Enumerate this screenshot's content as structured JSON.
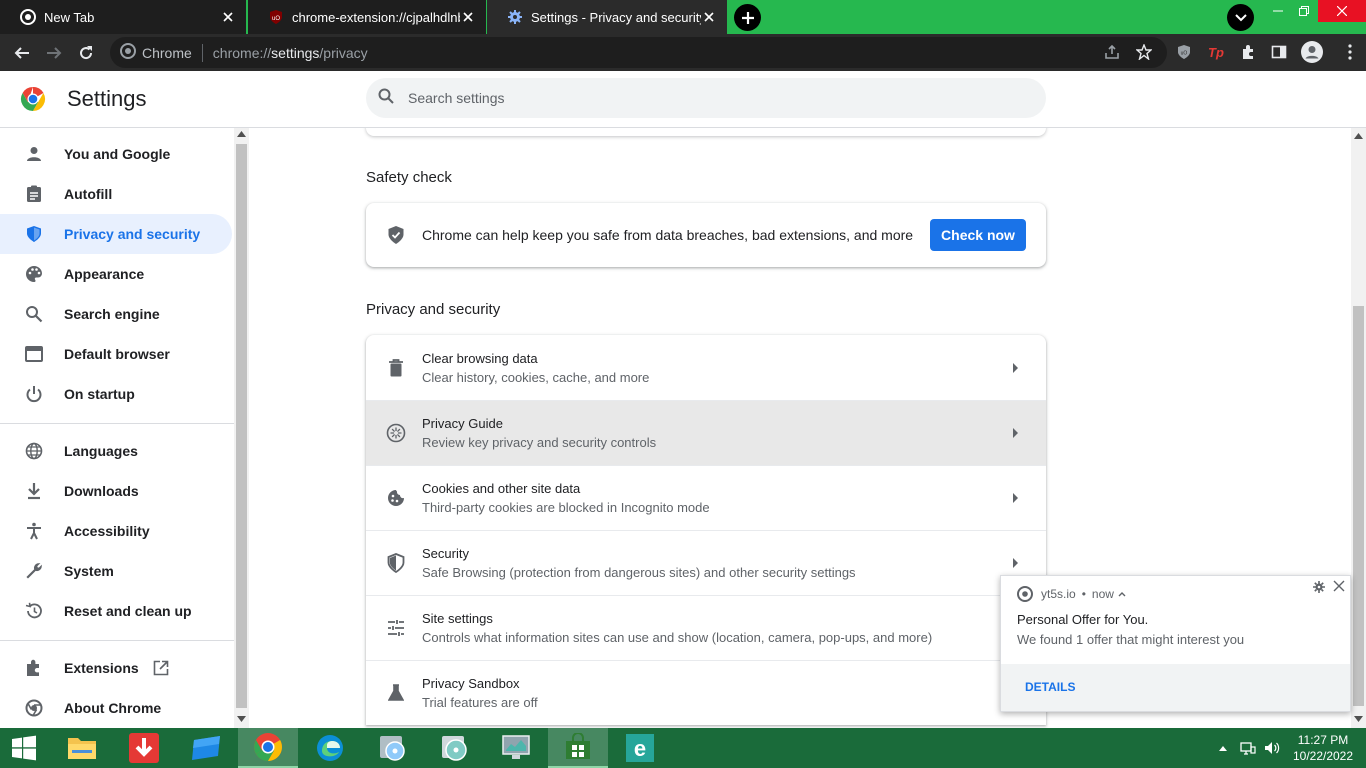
{
  "tabs": [
    {
      "title": "New Tab",
      "icon": "chrome-icon"
    },
    {
      "title": "chrome-extension://cjpalhdlnbpafiamejdnhcphjbkeiagm",
      "icon": "ublock-icon"
    },
    {
      "title": "Settings - Privacy and security",
      "icon": "gear-icon",
      "active": true
    }
  ],
  "toolbar": {
    "omnibox_site": "Chrome",
    "url_prefix": "chrome://",
    "url_host": "settings",
    "url_path": "/privacy"
  },
  "header": {
    "title": "Settings",
    "search_placeholder": "Search settings"
  },
  "sidebar": {
    "items": [
      {
        "label": "You and Google",
        "icon": "person-icon"
      },
      {
        "label": "Autofill",
        "icon": "clipboard-icon"
      },
      {
        "label": "Privacy and security",
        "icon": "shield-icon",
        "active": true
      },
      {
        "label": "Appearance",
        "icon": "palette-icon"
      },
      {
        "label": "Search engine",
        "icon": "search-icon"
      },
      {
        "label": "Default browser",
        "icon": "browser-icon"
      },
      {
        "label": "On startup",
        "icon": "power-icon"
      },
      {
        "label": "Languages",
        "icon": "globe-icon"
      },
      {
        "label": "Downloads",
        "icon": "download-icon"
      },
      {
        "label": "Accessibility",
        "icon": "accessibility-icon"
      },
      {
        "label": "System",
        "icon": "wrench-icon"
      },
      {
        "label": "Reset and clean up",
        "icon": "history-icon"
      },
      {
        "label": "Extensions",
        "icon": "puzzle-icon"
      },
      {
        "label": "About Chrome",
        "icon": "chrome-icon"
      }
    ]
  },
  "safety_check": {
    "heading": "Safety check",
    "text": "Chrome can help keep you safe from data breaches, bad extensions, and more",
    "button": "Check now"
  },
  "privacy": {
    "heading": "Privacy and security",
    "rows": [
      {
        "title": "Clear browsing data",
        "subtitle": "Clear history, cookies, cache, and more",
        "icon": "trash-icon"
      },
      {
        "title": "Privacy Guide",
        "subtitle": "Review key privacy and security controls",
        "icon": "compass-icon"
      },
      {
        "title": "Cookies and other site data",
        "subtitle": "Third-party cookies are blocked in Incognito mode",
        "icon": "cookie-icon"
      },
      {
        "title": "Security",
        "subtitle": "Safe Browsing (protection from dangerous sites) and other security settings",
        "icon": "shield-icon"
      },
      {
        "title": "Site settings",
        "subtitle": "Controls what information sites can use and show (location, camera, pop-ups, and more)",
        "icon": "tune-icon"
      },
      {
        "title": "Privacy Sandbox",
        "subtitle": "Trial features are off",
        "icon": "flask-icon"
      }
    ]
  },
  "notification": {
    "source": "yt5s.io",
    "time": "now",
    "title": "Personal Offer for You.",
    "body": "We found 1 offer that might interest you",
    "action": "DETAILS"
  },
  "taskbar": {
    "time": "11:27 PM",
    "date": "10/22/2022"
  },
  "colors": {
    "accent": "#1a73e8",
    "tabstrip": "#26b84f",
    "taskbar": "#1a6b3a",
    "active_nav_bg": "#e8f0fe"
  }
}
